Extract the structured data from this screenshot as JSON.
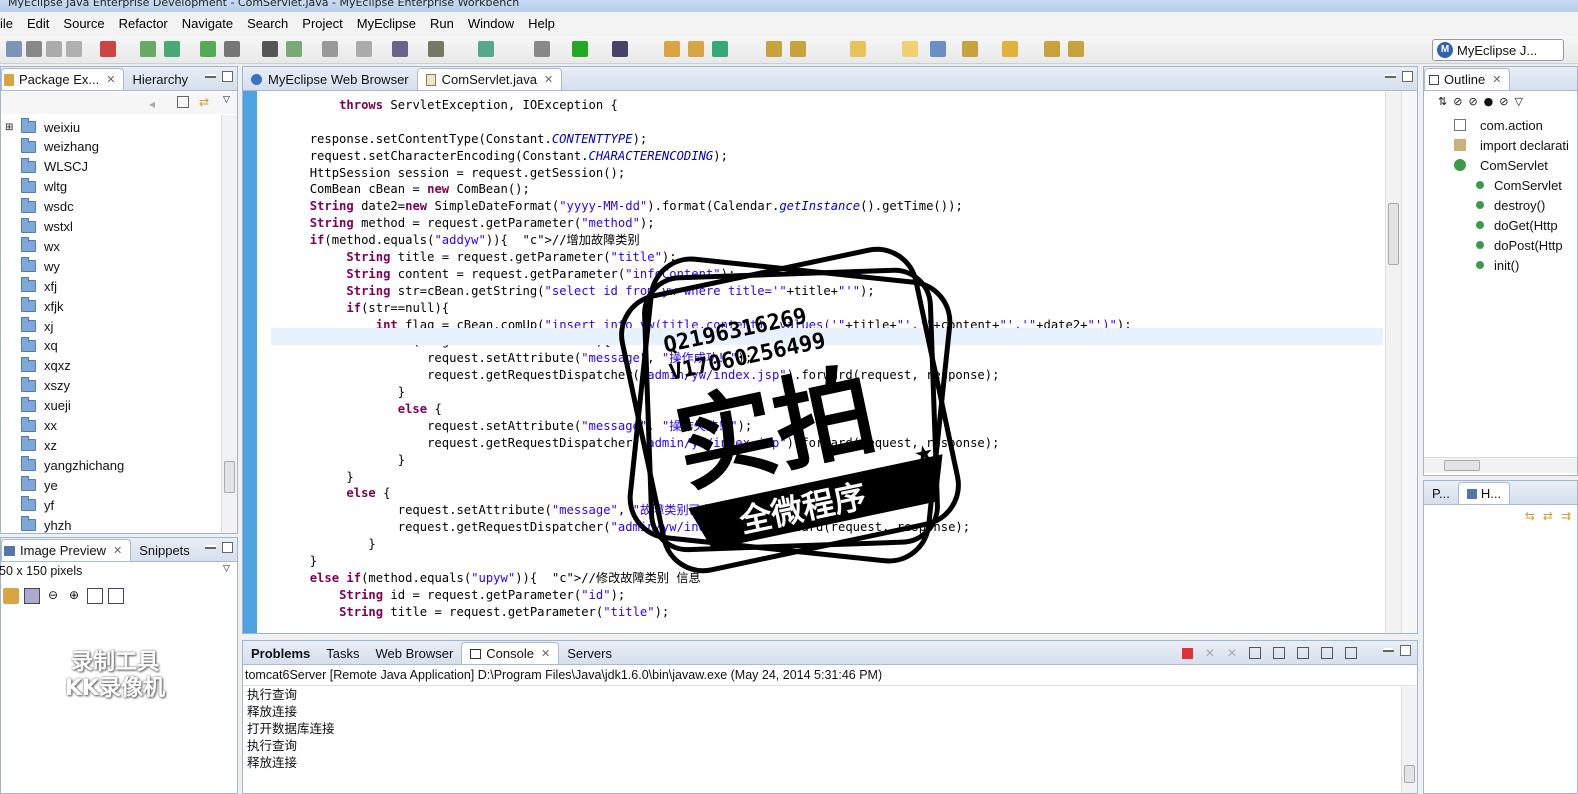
{
  "window": {
    "title": "MyEclipse Java Enterprise Development - ComServlet.java - MyEclipse Enterprise Workbench"
  },
  "menu": [
    "ile",
    "Edit",
    "Source",
    "Refactor",
    "Navigate",
    "Search",
    "Project",
    "MyEclipse",
    "Run",
    "Window",
    "Help"
  ],
  "perspective": {
    "label": "MyEclipse J..."
  },
  "package_explorer": {
    "tabs": [
      "Package Ex...",
      "Hierarchy"
    ],
    "items": [
      "weixiu",
      "weizhang",
      "WLSCJ",
      "wltg",
      "wsdc",
      "wstxl",
      "wx",
      "wy",
      "xfj",
      "xfjk",
      "xj",
      "xq",
      "xqxz",
      "xszy",
      "xueji",
      "xx",
      "xz",
      "yangzhichang",
      "ye",
      "yf",
      "yhzh"
    ]
  },
  "image_preview": {
    "tabs": [
      "Image Preview",
      "Snippets"
    ],
    "size_text": "50 x 150 pixels"
  },
  "editor": {
    "tabs": [
      "MyEclipse Web Browser",
      "ComServlet.java"
    ],
    "lines": [
      "            throws ServletException, IOException {",
      "",
      "        response.setContentType(Constant.CONTENTTYPE);",
      "        request.setCharacterEncoding(Constant.CHARACTERENCODING);",
      "        HttpSession session = request.getSession();",
      "        ComBean cBean = new ComBean();",
      "        String date2=new SimpleDateFormat(\"yyyy-MM-dd\").format(Calendar.getInstance().getTime());",
      "        String method = request.getParameter(\"method\");",
      "        if(method.equals(\"addyw\")){  //增加故障类别",
      "             String title = request.getParameter(\"title\");",
      "             String content = request.getParameter(\"infoContent\");",
      "             String str=cBean.getString(\"select id from yw where title='\"+title+\"'\");",
      "             if(str==null){",
      "                 int flag = cBean.comUp(\"insert into yw(title,content)  values('\"+title+\"','\"+content+\"','\"+date2+\"')\");",
      "                    if(flag == Constant.SUCCESS){",
      "                        request.setAttribute(\"message\", \"操作成功！\");",
      "                        request.getRequestDispatcher(\"admin/yw/index.jsp\").forward(request, response);",
      "                    }",
      "                    else {",
      "                        request.setAttribute(\"message\", \"操作失败！\");",
      "                        request.getRequestDispatcher(\"admin/yw/index.jsp\").forward(request, response);",
      "                    }",
      "             }",
      "             else {",
      "                    request.setAttribute(\"message\", \"故障类别已存在！\");",
      "                    request.getRequestDispatcher(\"admin/yw/index.jsp\").forward(request, response);",
      "                }",
      "        }",
      "        else if(method.equals(\"upyw\")){  //修改故障类别 信息",
      "            String id = request.getParameter(\"id\");",
      "            String title = request.getParameter(\"title\");"
    ]
  },
  "outline": {
    "tab": "Outline",
    "items": [
      "com.action",
      "import declarati",
      "ComServlet",
      "ComServlet",
      "destroy()",
      "doGet(Http",
      "doPost(Http",
      "init()"
    ]
  },
  "small_panel": {
    "tabs": [
      "P...",
      "H..."
    ]
  },
  "console": {
    "tabs": [
      "Problems",
      "Tasks",
      "Web Browser",
      "Console",
      "Servers"
    ],
    "header": "tomcat6Server [Remote Java Application] D:\\Program Files\\Java\\jdk1.6.0\\bin\\javaw.exe (May 24, 2014 5:31:46 PM)",
    "lines": [
      "执行查询",
      "释放连接",
      "打开数据库连接",
      "执行查询",
      "释放连接"
    ]
  },
  "watermark": {
    "qq": "Q2196316269",
    "v": "V17060256499",
    "main": "实拍",
    "banner": "全微程序",
    "recorder_line1": "录制工具",
    "recorder_line2": "KK录像机"
  },
  "colors": {
    "accent": "#2f62b5",
    "stamp": "#000000",
    "editor_bg": "#ffffff"
  }
}
